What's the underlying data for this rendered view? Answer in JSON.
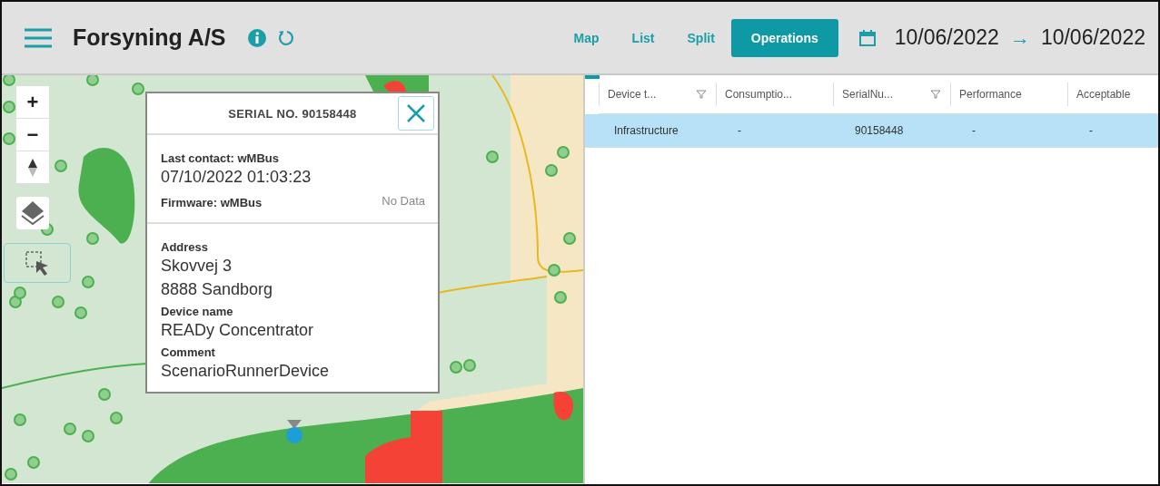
{
  "header": {
    "title": "Forsyning A/S",
    "date_from": "10/06/2022",
    "arrow": "→",
    "date_to": "10/06/2022"
  },
  "tabs": [
    {
      "label": "Map",
      "selected": false
    },
    {
      "label": "List",
      "selected": false
    },
    {
      "label": "Split",
      "selected": false
    },
    {
      "label": "Operations",
      "selected": true
    }
  ],
  "map_controls": {
    "zoom_in": "+",
    "zoom_out": "−"
  },
  "popup": {
    "title": "SERIAL NO. 90158448",
    "last_contact_label": "Last contact: wMBus",
    "last_contact_value": "07/10/2022 01:03:23",
    "firmware_label": "Firmware: wMBus",
    "firmware_value": "No Data",
    "fields": [
      {
        "label": "Address",
        "lines": [
          "Skovvej 3",
          "8888 Sandborg"
        ]
      },
      {
        "label": "Device name",
        "lines": [
          "READy Concentrator"
        ]
      },
      {
        "label": "Comment",
        "lines": [
          "ScenarioRunnerDevice"
        ]
      }
    ]
  },
  "table": {
    "columns": [
      {
        "label": "Device t...",
        "filter": true
      },
      {
        "label": "Consumptio...",
        "filter": false
      },
      {
        "label": "SerialNu...",
        "filter": true
      },
      {
        "label": "Performance",
        "filter": false
      },
      {
        "label": "Acceptable",
        "filter": false
      }
    ],
    "rows": [
      {
        "selected": true,
        "cells": [
          "Infrastructure",
          "-",
          "90158448",
          "-",
          "-"
        ]
      }
    ]
  }
}
